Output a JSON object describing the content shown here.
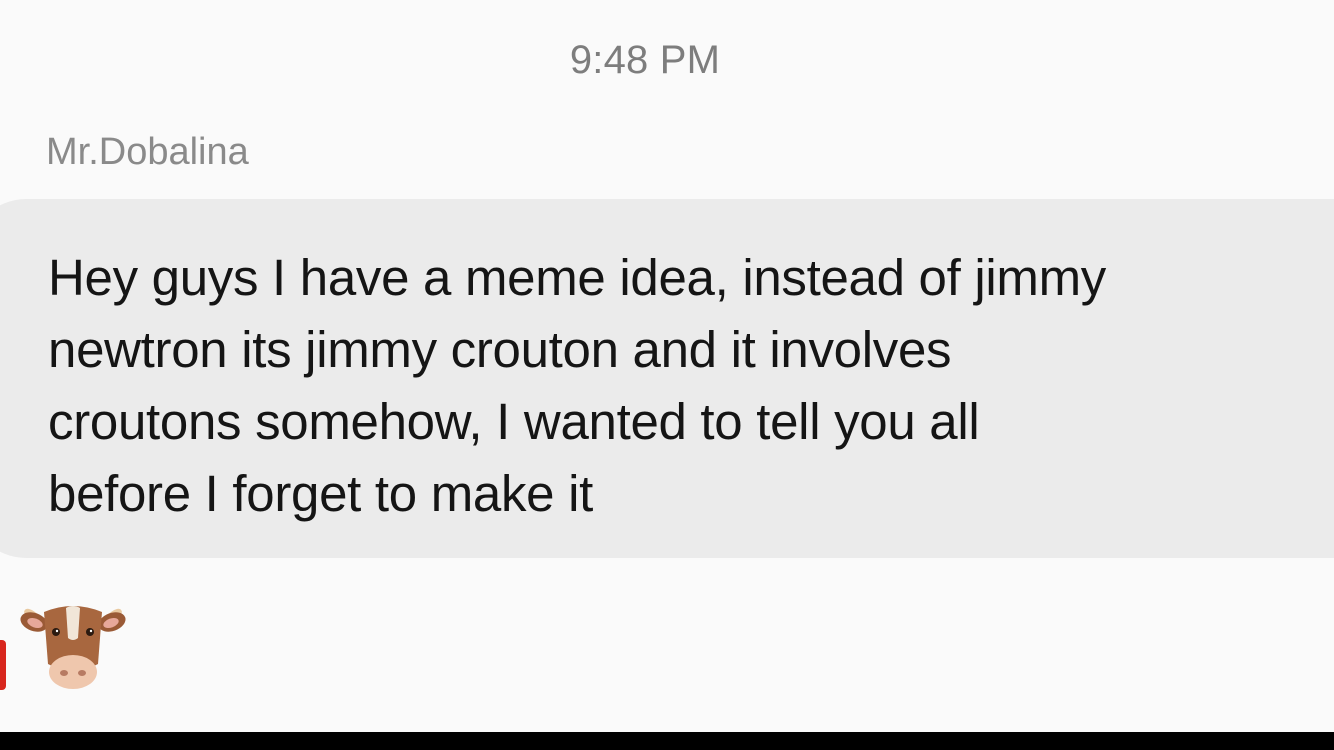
{
  "conversation": {
    "timestamp": "9:48 PM",
    "messages": [
      {
        "sender": "Mr.Dobalina",
        "text": "Hey guys I have a meme idea, instead of jimmy\nnewtron its jimmy crouton and it involves\ncroutons somehow, I wanted to tell you all\nbefore I forget to make it",
        "avatar_icon": "cow-face-icon"
      }
    ]
  },
  "colors": {
    "background": "#fafafa",
    "bubble": "#ebebeb",
    "text": "#151515",
    "meta_text": "#7d7d7d"
  }
}
